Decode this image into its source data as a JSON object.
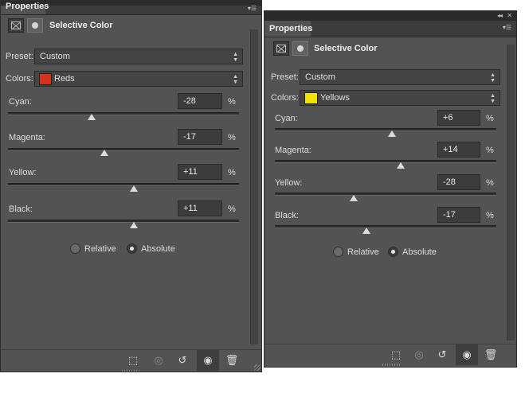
{
  "panels": [
    {
      "tab_label": "Properties",
      "title": "Selective Color",
      "preset_label": "Preset:",
      "preset_value": "Custom",
      "colors_label": "Colors:",
      "colors_value": "Reds",
      "swatch_color": "#d4321c",
      "sliders": [
        {
          "label": "Cyan:",
          "value": "-28",
          "unit": "%",
          "percent": -28
        },
        {
          "label": "Magenta:",
          "value": "-17",
          "unit": "%",
          "percent": -17
        },
        {
          "label": "Yellow:",
          "value": "+11",
          "unit": "%",
          "percent": 11
        },
        {
          "label": "Black:",
          "value": "+11",
          "unit": "%",
          "percent": 11
        }
      ],
      "radio_relative": "Relative",
      "radio_absolute": "Absolute",
      "selected_method": "absolute"
    },
    {
      "tab_label": "Properties",
      "title": "Selective Color",
      "preset_label": "Preset:",
      "preset_value": "Custom",
      "colors_label": "Colors:",
      "colors_value": "Yellows",
      "swatch_color": "#f2e200",
      "sliders": [
        {
          "label": "Cyan:",
          "value": "+6",
          "unit": "%",
          "percent": 6
        },
        {
          "label": "Magenta:",
          "value": "+14",
          "unit": "%",
          "percent": 14
        },
        {
          "label": "Yellow:",
          "value": "-28",
          "unit": "%",
          "percent": -28
        },
        {
          "label": "Black:",
          "value": "-17",
          "unit": "%",
          "percent": -17
        }
      ],
      "radio_relative": "Relative",
      "radio_absolute": "Absolute",
      "selected_method": "absolute"
    }
  ],
  "icons": {
    "adjustment": "adjustment-layer-icon",
    "mask": "layer-mask-icon",
    "clip": "clip-to-layer-icon",
    "view_previous": "view-previous-state-icon",
    "reset": "reset-icon",
    "visibility": "eye-icon",
    "delete": "trash-icon",
    "collapse": "collapse-icon",
    "close": "close-icon",
    "panel_menu": "panel-menu-icon"
  },
  "theme": {
    "panel_bg": "#535353",
    "field_bg": "#3c3c3c",
    "text": "#dcdcdc"
  }
}
